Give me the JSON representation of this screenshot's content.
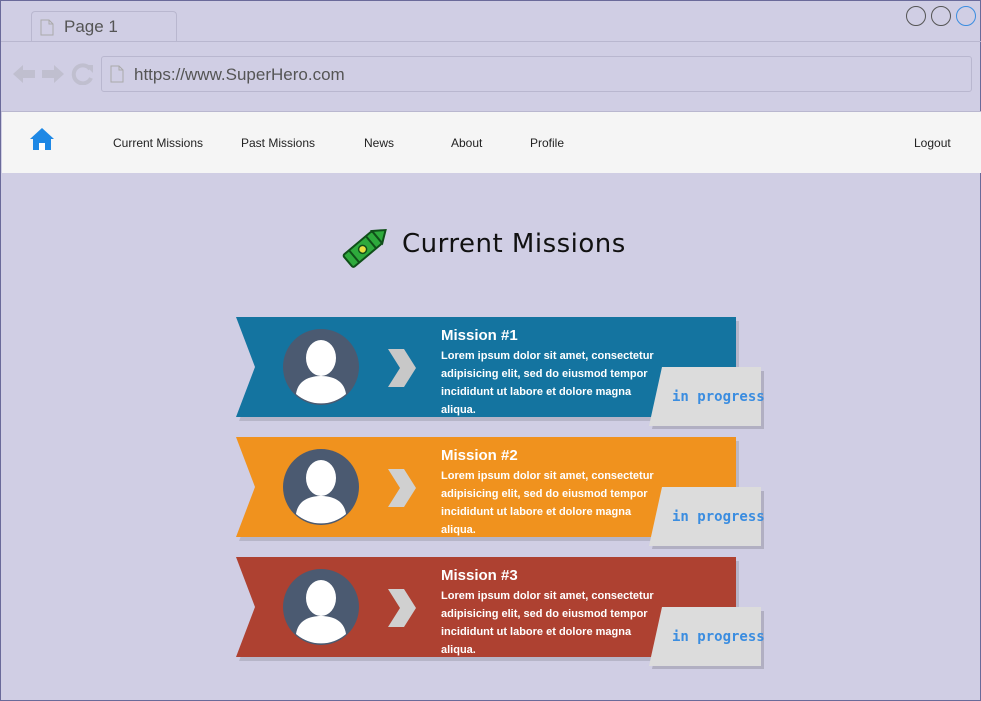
{
  "browser": {
    "tab_title": "Page 1",
    "url": "https://www.SuperHero.com"
  },
  "nav": {
    "items": [
      "Current Missions",
      "Past Missions",
      "News",
      "About",
      "Profile"
    ],
    "logout": "Logout"
  },
  "page": {
    "heading": "Current Missions"
  },
  "missions": [
    {
      "title": "Mission #1",
      "description": "Lorem ipsum dolor sit amet, consectetur adipisicing elit, sed do eiusmod tempor incididunt ut labore et dolore magna aliqua.",
      "status": "in progress",
      "color": "#1474a0"
    },
    {
      "title": "Mission #2",
      "description": "Lorem ipsum dolor sit amet, consectetur adipisicing elit, sed do eiusmod tempor incididunt ut labore et dolore magna aliqua.",
      "status": "in progress",
      "color": "#f0921e"
    },
    {
      "title": "Mission #3",
      "description": "Lorem ipsum dolor sit amet, consectetur adipisicing elit, sed do eiusmod tempor incididunt ut labore et dolore magna aliqua.",
      "status": "in progress",
      "color": "#ae4131"
    }
  ],
  "colors": {
    "background": "#d0cee4",
    "navbar": "#f5f5f5",
    "status_text": "#3b8de0",
    "status_tag": "#dcdcdc",
    "avatar_bg": "#4b5a71"
  },
  "icons": {
    "home": "home-icon",
    "heading": "crayon-icon",
    "avatar": "user-avatar-icon",
    "arrow": "chevron-right-icon"
  }
}
